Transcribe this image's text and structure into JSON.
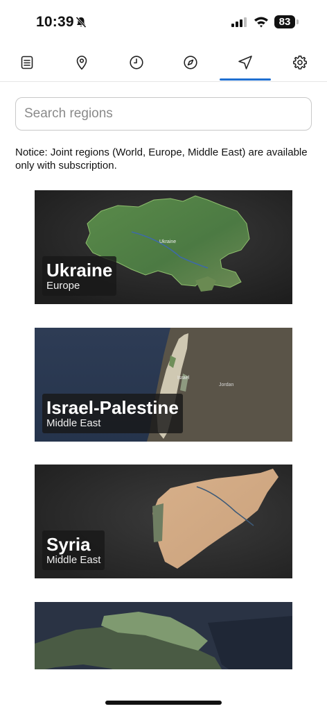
{
  "status_bar": {
    "time": "10:39",
    "battery": "83",
    "icons": [
      "bell-slash-icon",
      "cellular-signal-icon",
      "wifi-icon",
      "battery-icon"
    ]
  },
  "tabs": [
    {
      "name": "list",
      "icon": "list-icon"
    },
    {
      "name": "location",
      "icon": "map-pin-icon"
    },
    {
      "name": "history",
      "icon": "clock-icon"
    },
    {
      "name": "explore",
      "icon": "compass-icon"
    },
    {
      "name": "navigate",
      "icon": "navigation-arrow-icon",
      "active": true
    },
    {
      "name": "settings",
      "icon": "gear-icon"
    }
  ],
  "search": {
    "placeholder": "Search regions",
    "value": ""
  },
  "notice": "Notice: Joint regions (World, Europe, Middle East) are available only with subscription.",
  "regions": [
    {
      "title": "Ukraine",
      "subtitle": "Europe",
      "map_label": "Ukraine"
    },
    {
      "title": "Israel-Palestine",
      "subtitle": "Middle East",
      "map_label": "Israel",
      "map_label_2": "Jordan"
    },
    {
      "title": "Syria",
      "subtitle": "Middle East"
    },
    {
      "title": "",
      "subtitle": ""
    }
  ],
  "colors": {
    "accent": "#1f6fd1",
    "card_bg": "#2b2b2b"
  }
}
